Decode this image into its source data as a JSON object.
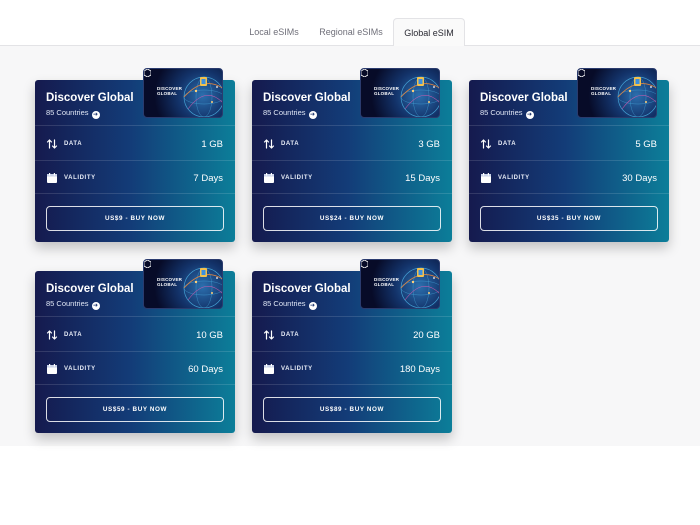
{
  "tabs": [
    {
      "label": "Local eSIMs",
      "active": false
    },
    {
      "label": "Regional eSIMs",
      "active": false
    },
    {
      "label": "Global eSIM",
      "active": true
    }
  ],
  "labels": {
    "data": "DATA",
    "validity": "VALIDITY",
    "sim_brand_line1": "DISCOVER",
    "sim_brand_line2": "GLOBAL"
  },
  "colors": {
    "card_gradient_start": "#151a4e",
    "card_gradient_end": "#0c7e99",
    "active_tab_bg": "#fafafa",
    "content_bg": "#f7f7f8"
  },
  "icons": {
    "data": "up-down-arrows-icon",
    "validity": "calendar-icon",
    "countries_link": "arrow-right-circle-icon"
  },
  "plans": [
    {
      "title": "Discover Global",
      "countries": "85 Countries",
      "data": "1 GB",
      "validity": "7 Days",
      "cta": "US$9 - BUY NOW"
    },
    {
      "title": "Discover Global",
      "countries": "85 Countries",
      "data": "3 GB",
      "validity": "15 Days",
      "cta": "US$24 - BUY NOW"
    },
    {
      "title": "Discover Global",
      "countries": "85 Countries",
      "data": "5 GB",
      "validity": "30 Days",
      "cta": "US$35 - BUY NOW"
    },
    {
      "title": "Discover Global",
      "countries": "85 Countries",
      "data": "10 GB",
      "validity": "60 Days",
      "cta": "US$59 - BUY NOW"
    },
    {
      "title": "Discover Global",
      "countries": "85 Countries",
      "data": "20 GB",
      "validity": "180 Days",
      "cta": "US$89 - BUY NOW"
    }
  ]
}
